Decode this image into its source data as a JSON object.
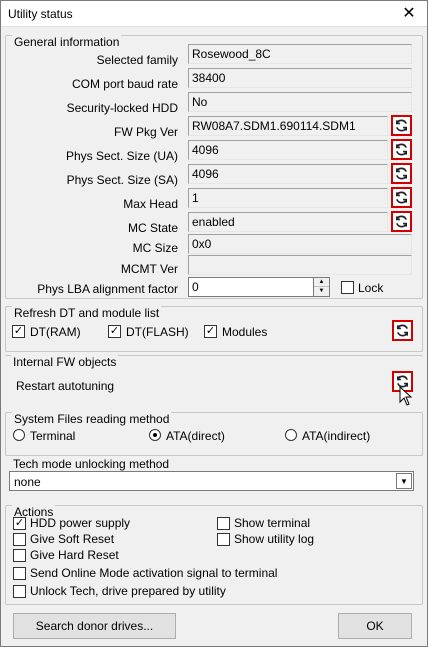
{
  "window": {
    "title": "Utility status",
    "close_glyph": "✕"
  },
  "general": {
    "title": "General information",
    "fields": [
      {
        "label": "Selected family",
        "value": "Rosewood_8C"
      },
      {
        "label": "COM port baud rate",
        "value": "38400"
      },
      {
        "label": "Security-locked HDD",
        "value": "No"
      },
      {
        "label": "FW Pkg Ver",
        "value": "RW08A7.SDM1.690114.SDM1"
      },
      {
        "label": "Phys Sect. Size (UA)",
        "value": "4096"
      },
      {
        "label": "Phys Sect. Size (SA)",
        "value": "4096"
      },
      {
        "label": "Max Head",
        "value": "1"
      },
      {
        "label": "MC State",
        "value": "enabled"
      },
      {
        "label": "MC Size",
        "value": "0x0"
      },
      {
        "label": "MCMT Ver",
        "value": ""
      },
      {
        "label": "Phys LBA alignment factor",
        "value": "0"
      }
    ],
    "lock_label": "Lock"
  },
  "refresh_dt": {
    "title": "Refresh DT and module list",
    "items": [
      {
        "label": "DT(RAM)",
        "checked": true
      },
      {
        "label": "DT(FLASH)",
        "checked": true
      },
      {
        "label": "Modules",
        "checked": true
      }
    ]
  },
  "internal_fw": {
    "title": "Internal FW objects",
    "restart_label": "Restart autotuning"
  },
  "system_files": {
    "title": "System Files reading method",
    "options": [
      {
        "label": "Terminal",
        "selected": false
      },
      {
        "label": "ATA(direct)",
        "selected": true
      },
      {
        "label": "ATA(indirect)",
        "selected": false
      }
    ]
  },
  "tech_mode": {
    "title": "Tech mode unlocking method",
    "selected": "none"
  },
  "actions": {
    "title": "Actions",
    "items": [
      {
        "label": "HDD power supply",
        "checked": true
      },
      {
        "label": "Give Soft Reset",
        "checked": false
      },
      {
        "label": "Give Hard Reset",
        "checked": false
      },
      {
        "label": "Send Online Mode activation signal to terminal",
        "checked": false
      },
      {
        "label": "Unlock Tech, drive prepared by utility",
        "checked": false
      },
      {
        "label": "Show terminal",
        "checked": false
      },
      {
        "label": "Show utility log",
        "checked": false
      }
    ]
  },
  "buttons": {
    "search_donor": "Search donor drives...",
    "ok": "OK"
  },
  "icons": {
    "refresh": "refresh-icon",
    "accent_border": "#d40000"
  }
}
